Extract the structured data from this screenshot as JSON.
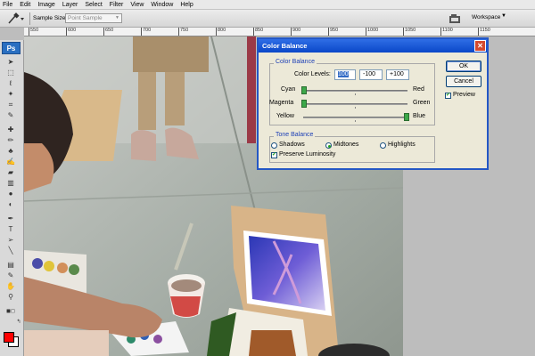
{
  "menu": [
    "File",
    "Edit",
    "Image",
    "Layer",
    "Select",
    "Filter",
    "View",
    "Window",
    "Help"
  ],
  "options_bar": {
    "sample_size_label": "Sample Size:",
    "sample_size_value": "Point Sample",
    "workspace_label": "Workspace"
  },
  "ruler_ticks": [
    "550",
    "600",
    "650",
    "700",
    "750",
    "800",
    "850",
    "900",
    "950",
    "1000",
    "1050",
    "1100",
    "1150"
  ],
  "toolbox": {
    "logo": "Ps"
  },
  "dialog": {
    "title": "Color Balance",
    "color_balance_group": "Color Balance",
    "color_levels_label": "Color Levels:",
    "levels": [
      "100",
      "-100",
      "+100"
    ],
    "sliders": [
      {
        "left": "Cyan",
        "right": "Red",
        "value": 100
      },
      {
        "left": "Magenta",
        "right": "Green",
        "value": -100
      },
      {
        "left": "Yellow",
        "right": "Blue",
        "value": 100
      }
    ],
    "tone_balance_group": "Tone Balance",
    "tones": [
      "Shadows",
      "Midtones",
      "Highlights"
    ],
    "selected_tone": "Midtones",
    "preserve_luminosity": "Preserve Luminosity",
    "ok": "OK",
    "cancel": "Cancel",
    "preview": "Preview"
  },
  "colors": {
    "foreground": "#ff0000",
    "background": "#ffffff",
    "titlebar": "#0a47c8"
  }
}
